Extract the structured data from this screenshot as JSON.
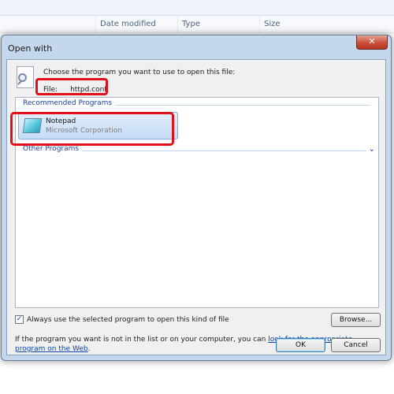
{
  "background": {
    "columns": [
      "Date modified",
      "Type",
      "Size"
    ]
  },
  "dialog": {
    "title": "Open with",
    "close_glyph": "✕",
    "prompt": "Choose the program you want to use to open this file:",
    "file_label": "File:",
    "file_name": "httpd.conf",
    "groups": {
      "recommended": "Recommended Programs",
      "other": "Other Programs"
    },
    "program": {
      "name": "Notepad",
      "publisher": "Microsoft Corporation"
    },
    "always_use": {
      "checked": true,
      "label": "Always use the selected program to open this kind of file"
    },
    "browse_label": "Browse...",
    "help_text": "If the program you want is not in the list or on your computer, you can",
    "help_link": "look for the appropriate program on the Web",
    "help_end": ".",
    "ok_label": "OK",
    "cancel_label": "Cancel"
  },
  "icons": [
    "file-search-icon",
    "notepad-icon",
    "chevron-down-icon",
    "close-icon"
  ],
  "colors": {
    "highlight": "#e0101f",
    "link": "#0645ad",
    "group_text": "#1e3f9a"
  }
}
